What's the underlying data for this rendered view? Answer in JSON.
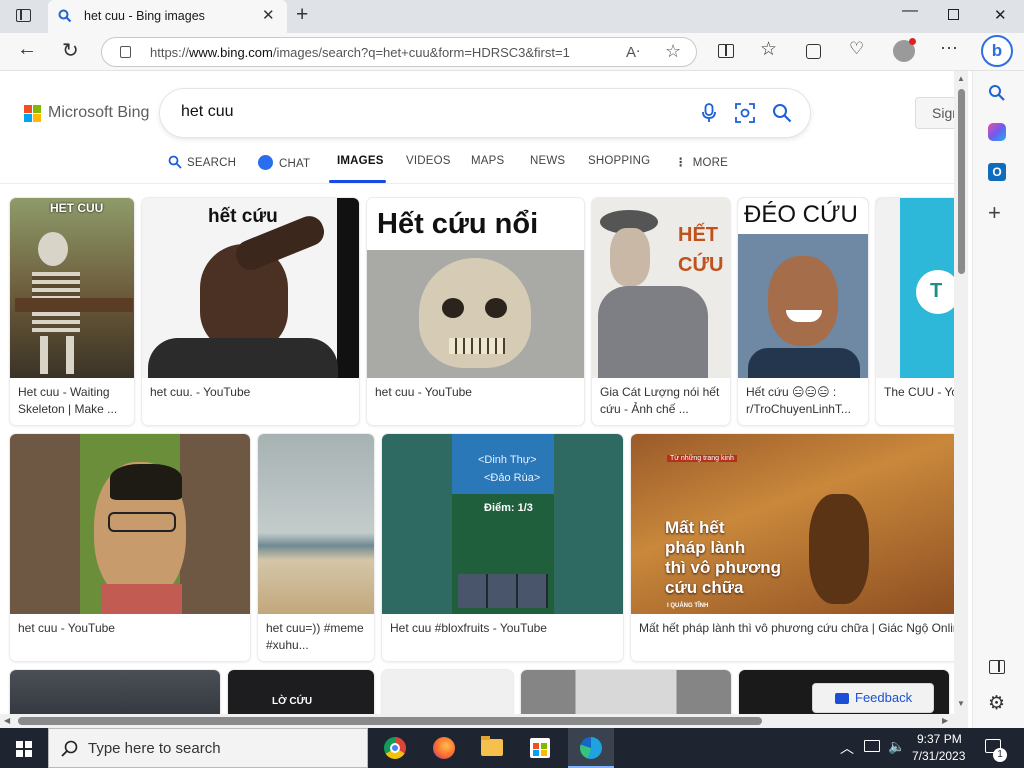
{
  "browser": {
    "tab_title": "het cuu - Bing images",
    "url_prefix": "https://",
    "url_host": "www.bing.com",
    "url_path": "/images/search?q=het+cuu&form=HDRSC3&first=1"
  },
  "bing": {
    "logo_text": "Microsoft Bing",
    "query": "het cuu",
    "signin_label": "Sign",
    "tabs": [
      {
        "label": "SEARCH"
      },
      {
        "label": "CHAT"
      },
      {
        "label": "IMAGES"
      },
      {
        "label": "VIDEOS"
      },
      {
        "label": "MAPS"
      },
      {
        "label": "NEWS"
      },
      {
        "label": "SHOPPING"
      },
      {
        "label": "MORE"
      }
    ],
    "active_tab": "IMAGES",
    "accent_color": "#174ae4"
  },
  "results": {
    "row1": [
      {
        "caption": "Het cuu - Waiting\nSkeleton | Make ...",
        "overlay": "HET CUU"
      },
      {
        "caption": "het cuu. - YouTube",
        "overlay": "hết cứu"
      },
      {
        "caption": "het cuu - YouTube",
        "overlay": "Hết cứu nổi"
      },
      {
        "caption": "Gia Cát Lượng nói hết\ncứu - Ảnh chế ...",
        "overlay": "HẾT\nCỨU"
      },
      {
        "caption": "Hết cứu 😑😑😑 :\nr/TroChuyenLinhT...",
        "overlay": "ĐÉO CỨU"
      },
      {
        "caption": "The CUU - Yo",
        "overlay": ""
      }
    ],
    "row2": [
      {
        "caption": "het cuu - YouTube"
      },
      {
        "caption": "het cuu=)) #meme\n#xuhu..."
      },
      {
        "caption": "Het cuu #bloxfruits - YouTube",
        "overlay_lines": [
          "<Dinh Thự>",
          "<Đảo Rùa>",
          "Điểm: 1/3"
        ]
      },
      {
        "caption": "Mất hết pháp lành thì vô phương cứu chữa | Giác Ngộ Onlin",
        "overlay_tag": "Từ những trang kinh",
        "overlay_big": "Mất hết\npháp lành\nthì vô phương\ncứu chữa",
        "overlay_small": "I QUẢNG TĨNH"
      }
    ],
    "row3_overlay": "LỜ CỨU"
  },
  "feedback_label": "Feedback",
  "taskbar": {
    "search_placeholder": "Type here to search",
    "time": "9:37 PM",
    "date": "7/31/2023",
    "notification_count": "1"
  }
}
